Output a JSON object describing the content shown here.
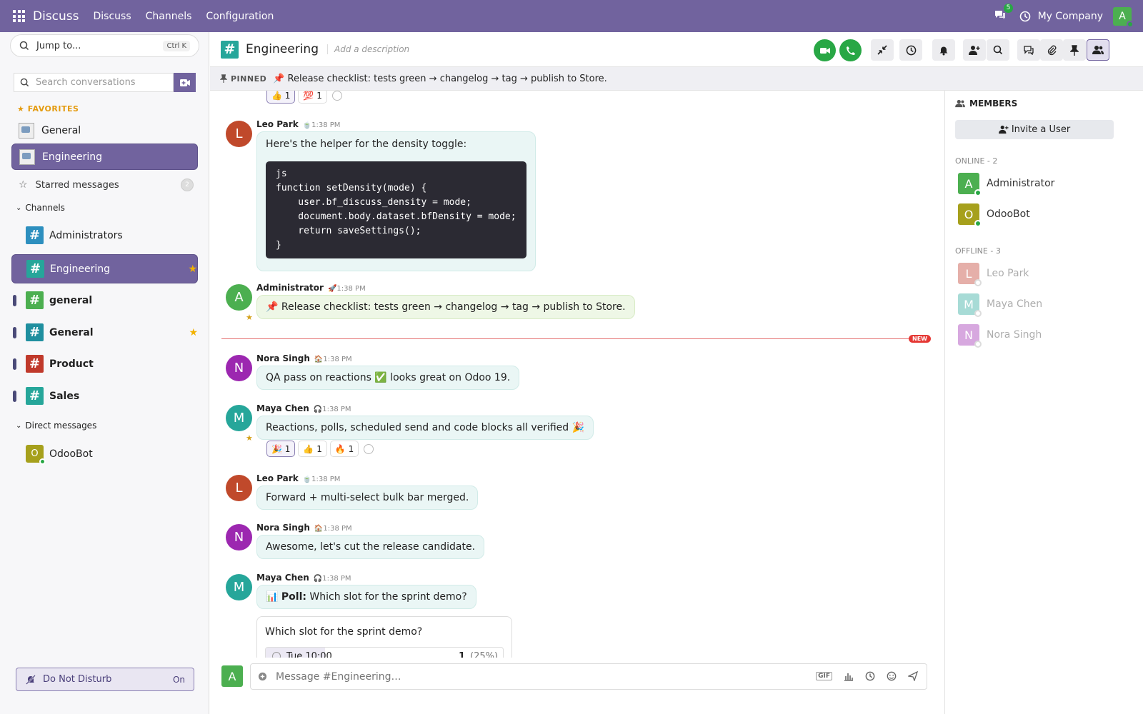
{
  "topbar": {
    "app": "Discuss",
    "menu": [
      "Discuss",
      "Channels",
      "Configuration"
    ],
    "notif_count": "5",
    "company": "My Company",
    "avatar": "A"
  },
  "sidebar": {
    "jump_placeholder": "Jump to...",
    "jump_shortcut": "Ctrl K",
    "search_placeholder": "Search conversations",
    "favorites_label": "FAVORITES",
    "favorites": [
      "General",
      "Engineering"
    ],
    "starred_label": "Starred messages",
    "starred_count": "2",
    "channels_label": "Channels",
    "channels": [
      {
        "name": "Administrators",
        "color": "#2d8fbf"
      },
      {
        "name": "Engineering",
        "color": "#26a69a"
      },
      {
        "name": "general",
        "color": "#4caf50"
      },
      {
        "name": "General",
        "color": "#1f8f9f"
      },
      {
        "name": "Product",
        "color": "#c0392b"
      },
      {
        "name": "Sales",
        "color": "#26a69a"
      }
    ],
    "dm_label": "Direct messages",
    "dms": [
      {
        "name": "OdooBot",
        "avatar": "O"
      }
    ],
    "dnd_label": "Do Not Disturb",
    "dnd_state": "On"
  },
  "header": {
    "channel": "Engineering",
    "description_placeholder": "Add a description"
  },
  "pinned": {
    "label": "PINNED",
    "text": "📌 Release checklist: tests green → changelog → tag → publish to Store."
  },
  "messages": [
    {
      "author": "Leo Park",
      "time": "1:38 PM",
      "avatar": "L",
      "text": "Here's the helper for the density toggle:",
      "code": "js\nfunction setDensity(mode) {\n    user.bf_discuss_density = mode;\n    document.body.dataset.bfDensity = mode;\n    return saveSettings();\n}"
    },
    {
      "author": "Administrator",
      "time": "1:38 PM",
      "avatar": "A",
      "text": "📌 Release checklist: tests green → changelog → tag → publish to Store."
    },
    {
      "author": "Nora Singh",
      "time": "1:38 PM",
      "avatar": "N",
      "text": "QA pass on reactions ✅ looks great on Odoo 19."
    },
    {
      "author": "Maya Chen",
      "time": "1:38 PM",
      "avatar": "M",
      "text": "Reactions, polls, scheduled send and code blocks all verified 🎉"
    },
    {
      "author": "Leo Park",
      "time": "1:38 PM",
      "avatar": "L",
      "text": "Forward + multi-select bulk bar merged."
    },
    {
      "author": "Nora Singh",
      "time": "1:38 PM",
      "avatar": "N",
      "text": "Awesome, let's cut the release candidate."
    },
    {
      "author": "Maya Chen",
      "time": "1:38 PM",
      "avatar": "M",
      "text_bold": "Poll:",
      "text": "Which slot for the sprint demo?"
    }
  ],
  "top_reactions": [
    {
      "emoji": "👍",
      "count": "1"
    },
    {
      "emoji": "💯",
      "count": "1"
    }
  ],
  "maya_reactions": [
    {
      "emoji": "🎉",
      "count": "1"
    },
    {
      "emoji": "👍",
      "count": "1"
    },
    {
      "emoji": "🔥",
      "count": "1"
    }
  ],
  "new_label": "NEW",
  "poll": {
    "question": "Which slot for the sprint demo?",
    "option": "Tue 10:00",
    "votes": "1",
    "percent": "(25%)",
    "fill": 0.25
  },
  "composer": {
    "avatar": "A",
    "placeholder": "Message #Engineering…",
    "gif": "GIF"
  },
  "members": {
    "title": "MEMBERS",
    "invite": "Invite a User",
    "online_label": "ONLINE - 2",
    "online": [
      {
        "name": "Administrator",
        "avatar": "A",
        "color": "#4caf50"
      },
      {
        "name": "OdooBot",
        "avatar": "O",
        "color": "#a6a01c"
      }
    ],
    "offline_label": "OFFLINE - 3",
    "offline": [
      {
        "name": "Leo Park",
        "avatar": "L",
        "color": "#c0392b"
      },
      {
        "name": "Maya Chen",
        "avatar": "M",
        "color": "#26a69a"
      },
      {
        "name": "Nora Singh",
        "avatar": "N",
        "color": "#9c27b0"
      }
    ]
  },
  "colors": {
    "brand": "#71639e",
    "online": "#28a745",
    "star": "#f2b200"
  }
}
